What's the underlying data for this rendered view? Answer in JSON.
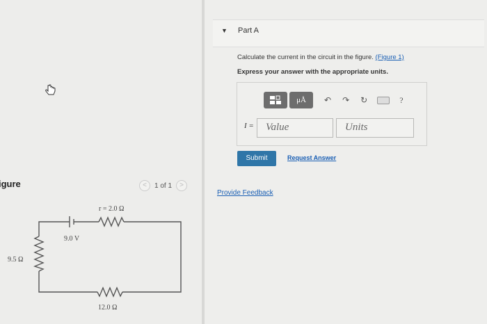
{
  "figure_panel": {
    "heading": "igure",
    "pager_text": "1 of 1",
    "prev_glyph": "<",
    "next_glyph": ">"
  },
  "circuit": {
    "internal_resistance_label": "r = 2.0 Ω",
    "emf_label": "9.0 V",
    "left_resistor_label": "9.5 Ω",
    "bottom_resistor_label": "12.0 Ω"
  },
  "part": {
    "title": "Part A",
    "question_text": "Calculate the current in the circuit in the figure. ",
    "figure_link": "(Figure 1)",
    "instruction": "Express your answer with the appropriate units."
  },
  "answer": {
    "toolbar_mu": "μÅ",
    "variable_label": "I =",
    "value_placeholder": "Value",
    "units_placeholder": "Units",
    "help_glyph": "?"
  },
  "actions": {
    "submit_label": "Submit",
    "request_answer_label": "Request Answer",
    "provide_feedback_label": "Provide Feedback"
  }
}
